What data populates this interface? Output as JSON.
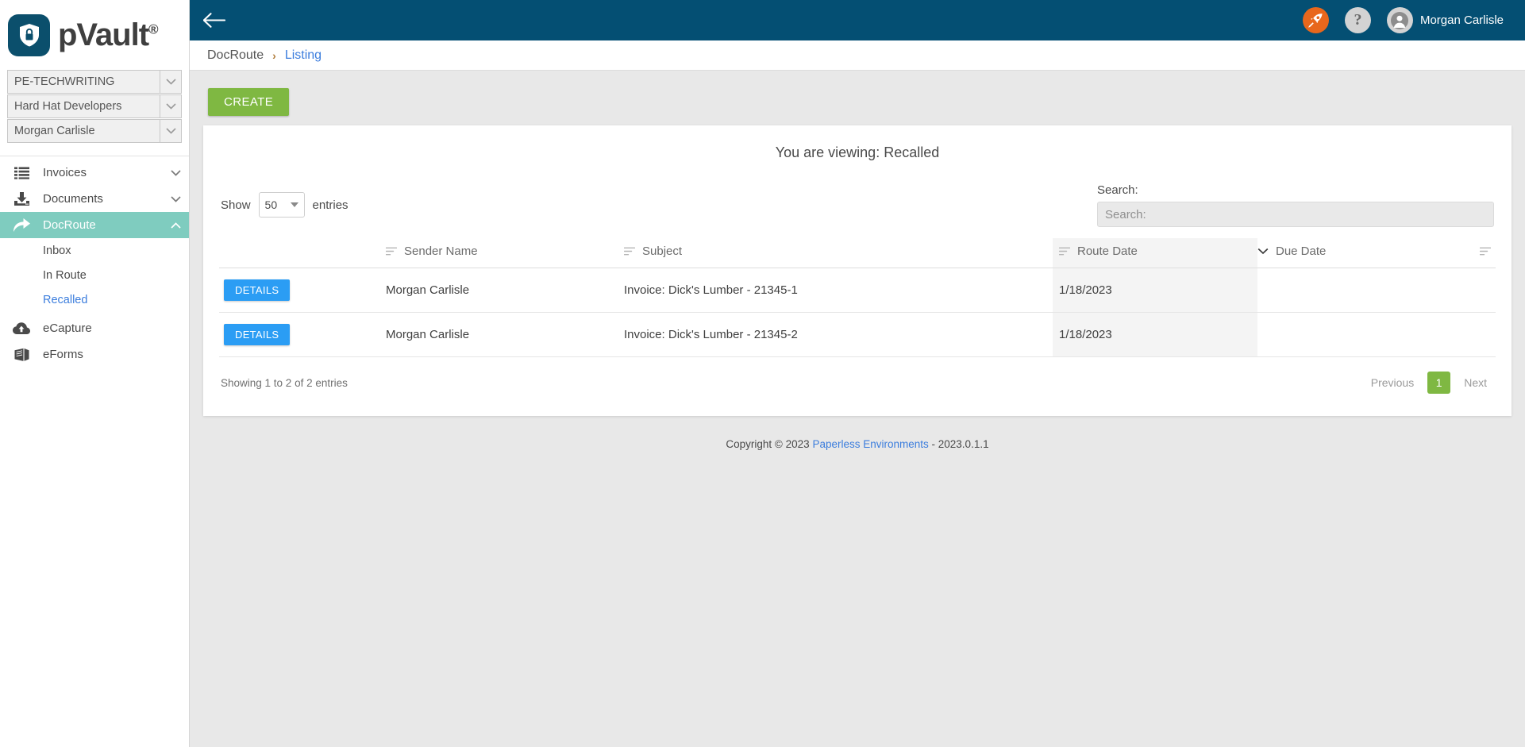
{
  "brand": {
    "name": "pVault",
    "registered": "®",
    "logo_icon": "shield-lock-icon",
    "logo_bg": "#0b4f6c"
  },
  "sidebar": {
    "selects": [
      {
        "label": "PE-TECHWRITING",
        "icon": "chevron-down-icon"
      },
      {
        "label": "Hard Hat Developers",
        "icon": "chevron-down-icon"
      },
      {
        "label": "Morgan Carlisle",
        "icon": "chevron-down-icon"
      }
    ],
    "nav": [
      {
        "label": "Invoices",
        "icon": "list-icon",
        "caret": "chevron-down-icon",
        "active": false
      },
      {
        "label": "Documents",
        "icon": "download-box-icon",
        "caret": "chevron-down-icon",
        "active": false
      },
      {
        "label": "DocRoute",
        "icon": "share-arrow-icon",
        "caret": "chevron-up-icon",
        "active": true
      }
    ],
    "subnav": [
      {
        "label": "Inbox",
        "current": false
      },
      {
        "label": "In Route",
        "current": false
      },
      {
        "label": "Recalled",
        "current": true
      }
    ],
    "nav_bottom": [
      {
        "label": "eCapture",
        "icon": "cloud-upload-icon"
      },
      {
        "label": "eForms",
        "icon": "book-icon"
      }
    ],
    "active_color": "#7fccbf",
    "link_color": "#3b7ddd"
  },
  "topbar": {
    "back_icon": "arrow-left-icon",
    "rocket_icon": "rocket-icon",
    "help_icon": "question-mark-icon",
    "avatar_icon": "user-avatar-icon",
    "user_name": "Morgan Carlisle",
    "bg": "#044f73",
    "rocket_bg": "#e8671c"
  },
  "breadcrumb": {
    "parent": "DocRoute",
    "separator": "›",
    "current": "Listing"
  },
  "toolbar": {
    "create_label": "CREATE",
    "create_color": "#7fb842"
  },
  "card": {
    "title": "You are viewing: Recalled",
    "show_label": "Show",
    "entries_label": "entries",
    "page_length": "50",
    "page_length_icon": "triangle-down-icon",
    "search_label": "Search:",
    "search_placeholder": "Search:",
    "search_value": ""
  },
  "table": {
    "columns": [
      {
        "label": "",
        "sort_icon": "",
        "sorted": false
      },
      {
        "label": "Sender Name",
        "sort_icon": "sort-icon",
        "sorted": false
      },
      {
        "label": "Subject",
        "sort_icon": "sort-icon",
        "sorted": false
      },
      {
        "label": "Route Date",
        "sort_icon": "chevron-down-icon",
        "sorted": true
      },
      {
        "label": "Due Date",
        "sort_icon": "sort-icon",
        "sorted": false
      }
    ],
    "details_label": "DETAILS",
    "details_color": "#2b9df4",
    "rows": [
      {
        "action": "DETAILS",
        "sender_name": "Morgan Carlisle",
        "subject": "Invoice: Dick's Lumber - 21345-1",
        "route_date": "1/18/2023",
        "due_date": ""
      },
      {
        "action": "DETAILS",
        "sender_name": "Morgan Carlisle",
        "subject": "Invoice: Dick's Lumber - 21345-2",
        "route_date": "1/18/2023",
        "due_date": ""
      }
    ]
  },
  "table_footer": {
    "info": "Showing 1 to 2 of 2 entries",
    "previous_label": "Previous",
    "page_number": "1",
    "next_label": "Next"
  },
  "page_footer": {
    "prefix": "Copyright © 2023",
    "link": "Paperless Environments",
    "suffix": "- 2023.0.1.1"
  }
}
